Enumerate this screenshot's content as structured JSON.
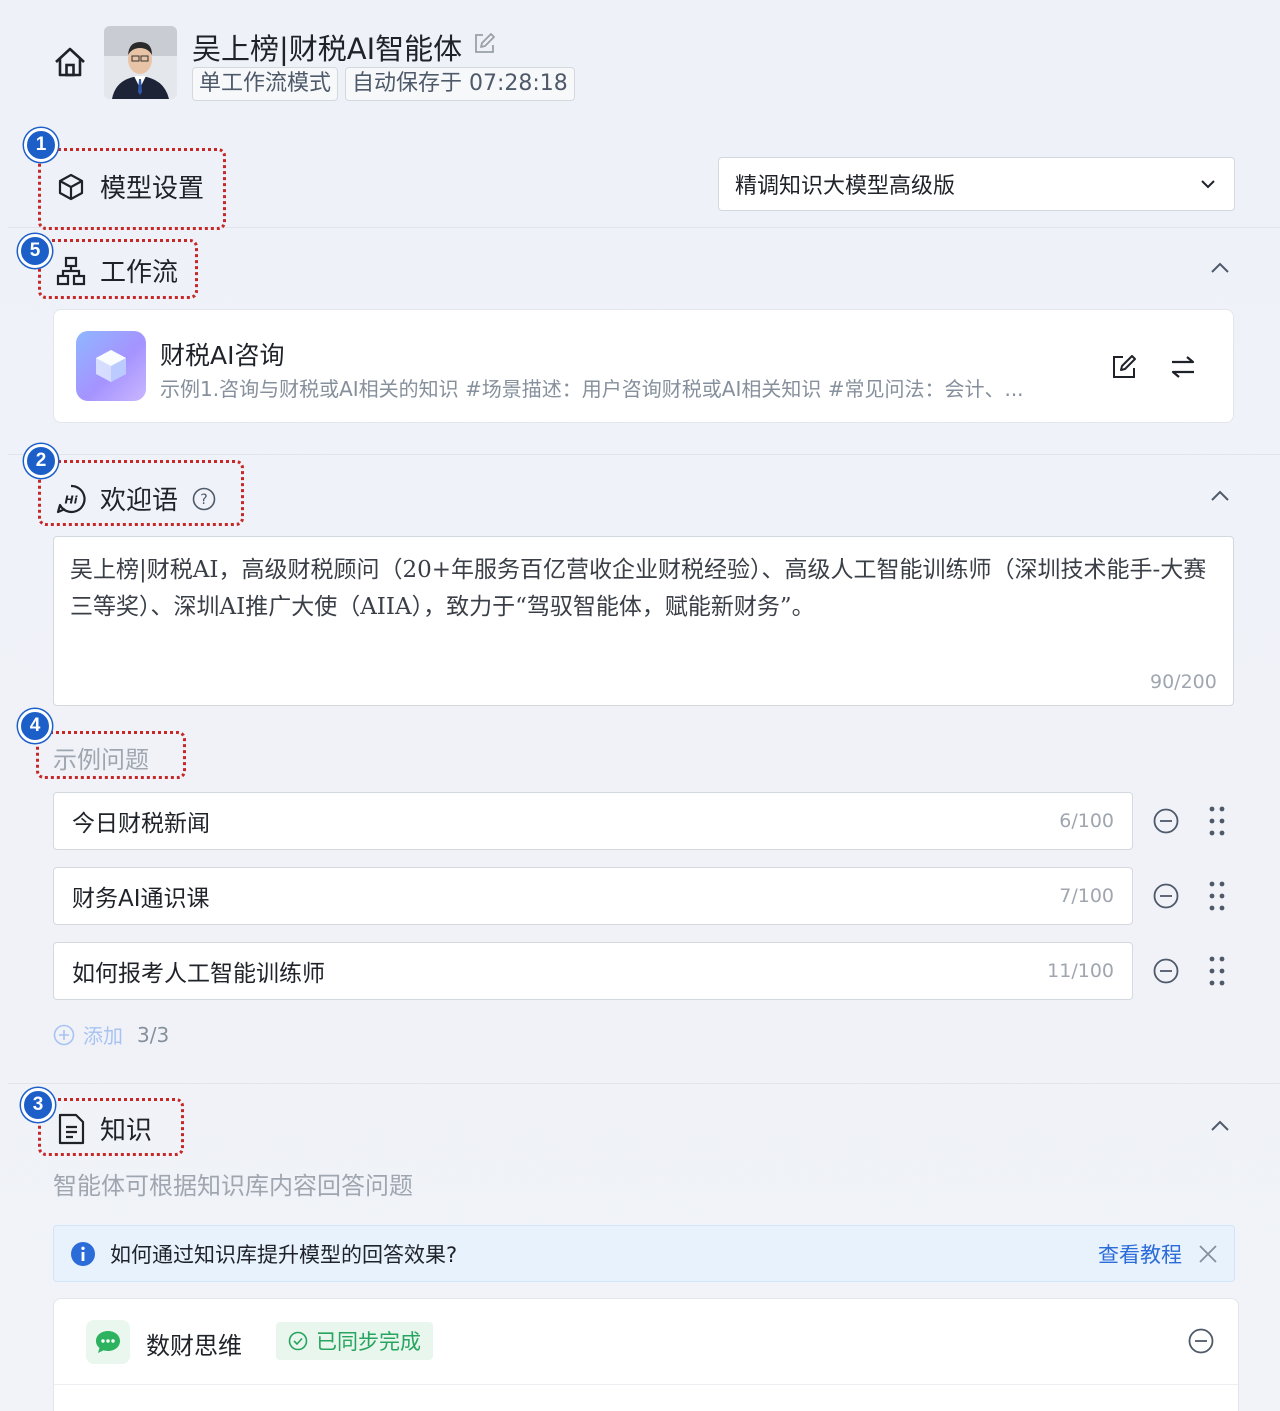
{
  "header": {
    "agent_name": "吴上榜|财税AI智能体",
    "mode_tag": "单工作流模式",
    "autosave_tag": "自动保存于 07:28:18"
  },
  "badges": [
    "1",
    "5",
    "2",
    "4",
    "3"
  ],
  "model_section": {
    "title": "模型设置",
    "selected_model": "精调知识大模型高级版"
  },
  "workflow_section": {
    "title": "工作流",
    "item": {
      "name": "财税AI咨询",
      "description": "示例1.咨询与财税或AI相关的知识 #场景描述：用户咨询财税或AI相关知识 #常见问法：会计、..."
    }
  },
  "welcome_section": {
    "title": "欢迎语",
    "text": "吴上榜|财税AI，高级财税顾问（20+年服务百亿营收企业财税经验）、高级人工智能训练师（深圳技术能手-大赛三等奖）、深圳AI推广大使（AIIA），致力于“驾驭智能体，赋能新财务”。",
    "count": "90/200"
  },
  "examples_section": {
    "title": "示例问题",
    "questions": [
      {
        "text": "今日财税新闻",
        "count": "6/100"
      },
      {
        "text": "财务AI通识课",
        "count": "7/100"
      },
      {
        "text": "如何报考人工智能训练师",
        "count": "11/100"
      }
    ],
    "add_label": "添加",
    "add_count": "3/3"
  },
  "knowledge_section": {
    "title": "知识",
    "description": "智能体可根据知识库内容回答问题",
    "tip": "如何通过知识库提升模型的回答效果?",
    "tip_link": "查看教程",
    "item": {
      "name": "数财思维",
      "status": "已同步完成"
    }
  },
  "colors": {
    "badge": "#1d5fc9",
    "dashed_outline": "#c62828",
    "link": "#2b6cd8",
    "success": "#27a55e"
  },
  "icons": [
    "home-icon",
    "edit-icon",
    "cube-icon",
    "workflow-icon",
    "hi-icon",
    "help-icon",
    "document-icon",
    "chevron-up-icon",
    "chevron-down-icon",
    "swap-icon",
    "minus-circle-icon",
    "drag-handle-icon",
    "plus-circle-icon",
    "info-icon",
    "close-icon",
    "chat-icon",
    "check-circle-icon"
  ]
}
